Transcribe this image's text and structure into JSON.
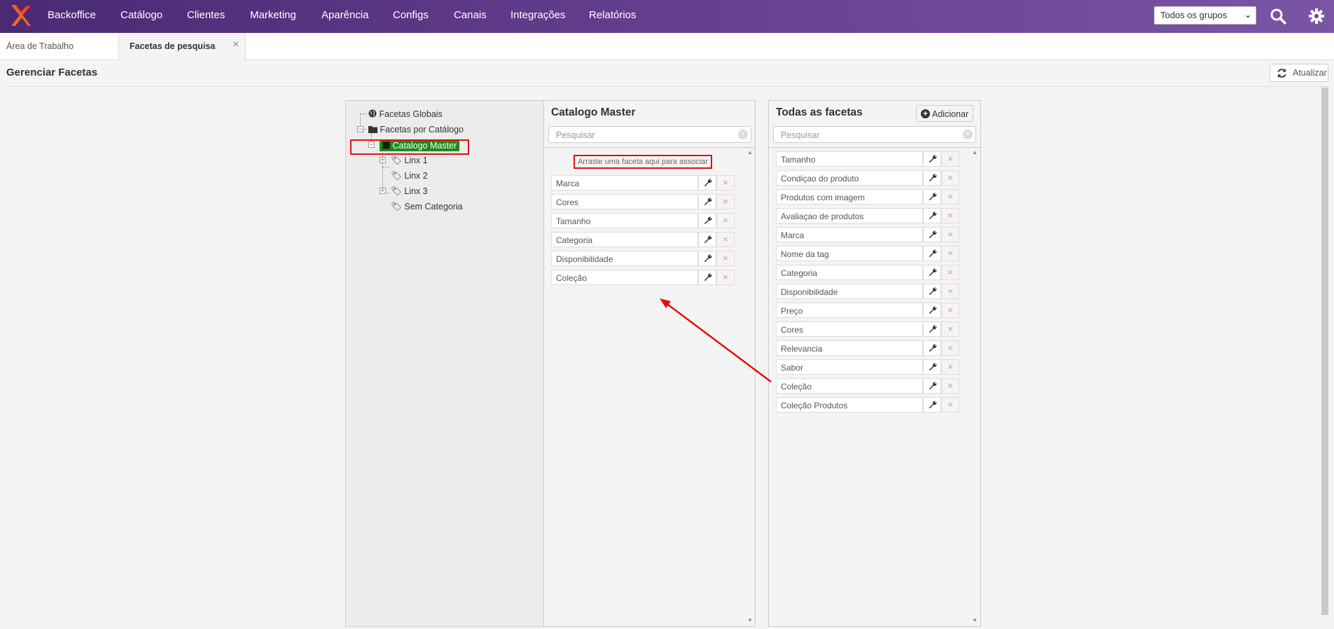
{
  "nav": {
    "items": [
      "Backoffice",
      "Catálogo",
      "Clientes",
      "Marketing",
      "Aparência",
      "Configs",
      "Canais",
      "Integrações",
      "Relatórios"
    ],
    "group_select": "Todos os grupos"
  },
  "tabs": {
    "workspace": "Área de Trabalho",
    "active": "Facetas de pesquisa",
    "close": "×"
  },
  "page": {
    "title": "Gerenciar Facetas",
    "refresh_label": "Atualizar"
  },
  "tree": {
    "global": "Facetas Globais",
    "by_catalog": "Facetas por Catálogo",
    "catalog_master": "Catalogo Master",
    "children": [
      "Linx 1",
      "Linx 2",
      "Linx 3",
      "Sem Categoria"
    ]
  },
  "middle": {
    "title": "Catalogo Master",
    "search_placeholder": "Pesquisar",
    "drop_hint": "Arraste uma faceta aqui para associar",
    "facets": [
      "Marca",
      "Cores",
      "Tamanho",
      "Categoria",
      "Disponibilidade",
      "Coleção"
    ]
  },
  "right": {
    "title": "Todas as facetas",
    "add_label": "Adicionar",
    "search_placeholder": "Pesquisar",
    "facets": [
      "Tamanho",
      "Condiçao do produto",
      "Produtos com imagem",
      "Avaliaçao de produtos",
      "Marca",
      "Nome da tag",
      "Categoria",
      "Disponibilidade",
      "Preço",
      "Cores",
      "Relevancia",
      "Sabor",
      "Coleção",
      "Coleção Produtos"
    ]
  },
  "colors": {
    "nav_bg": "#5b3585",
    "selected_node": "#1c8a1c",
    "highlight": "#e01010"
  }
}
